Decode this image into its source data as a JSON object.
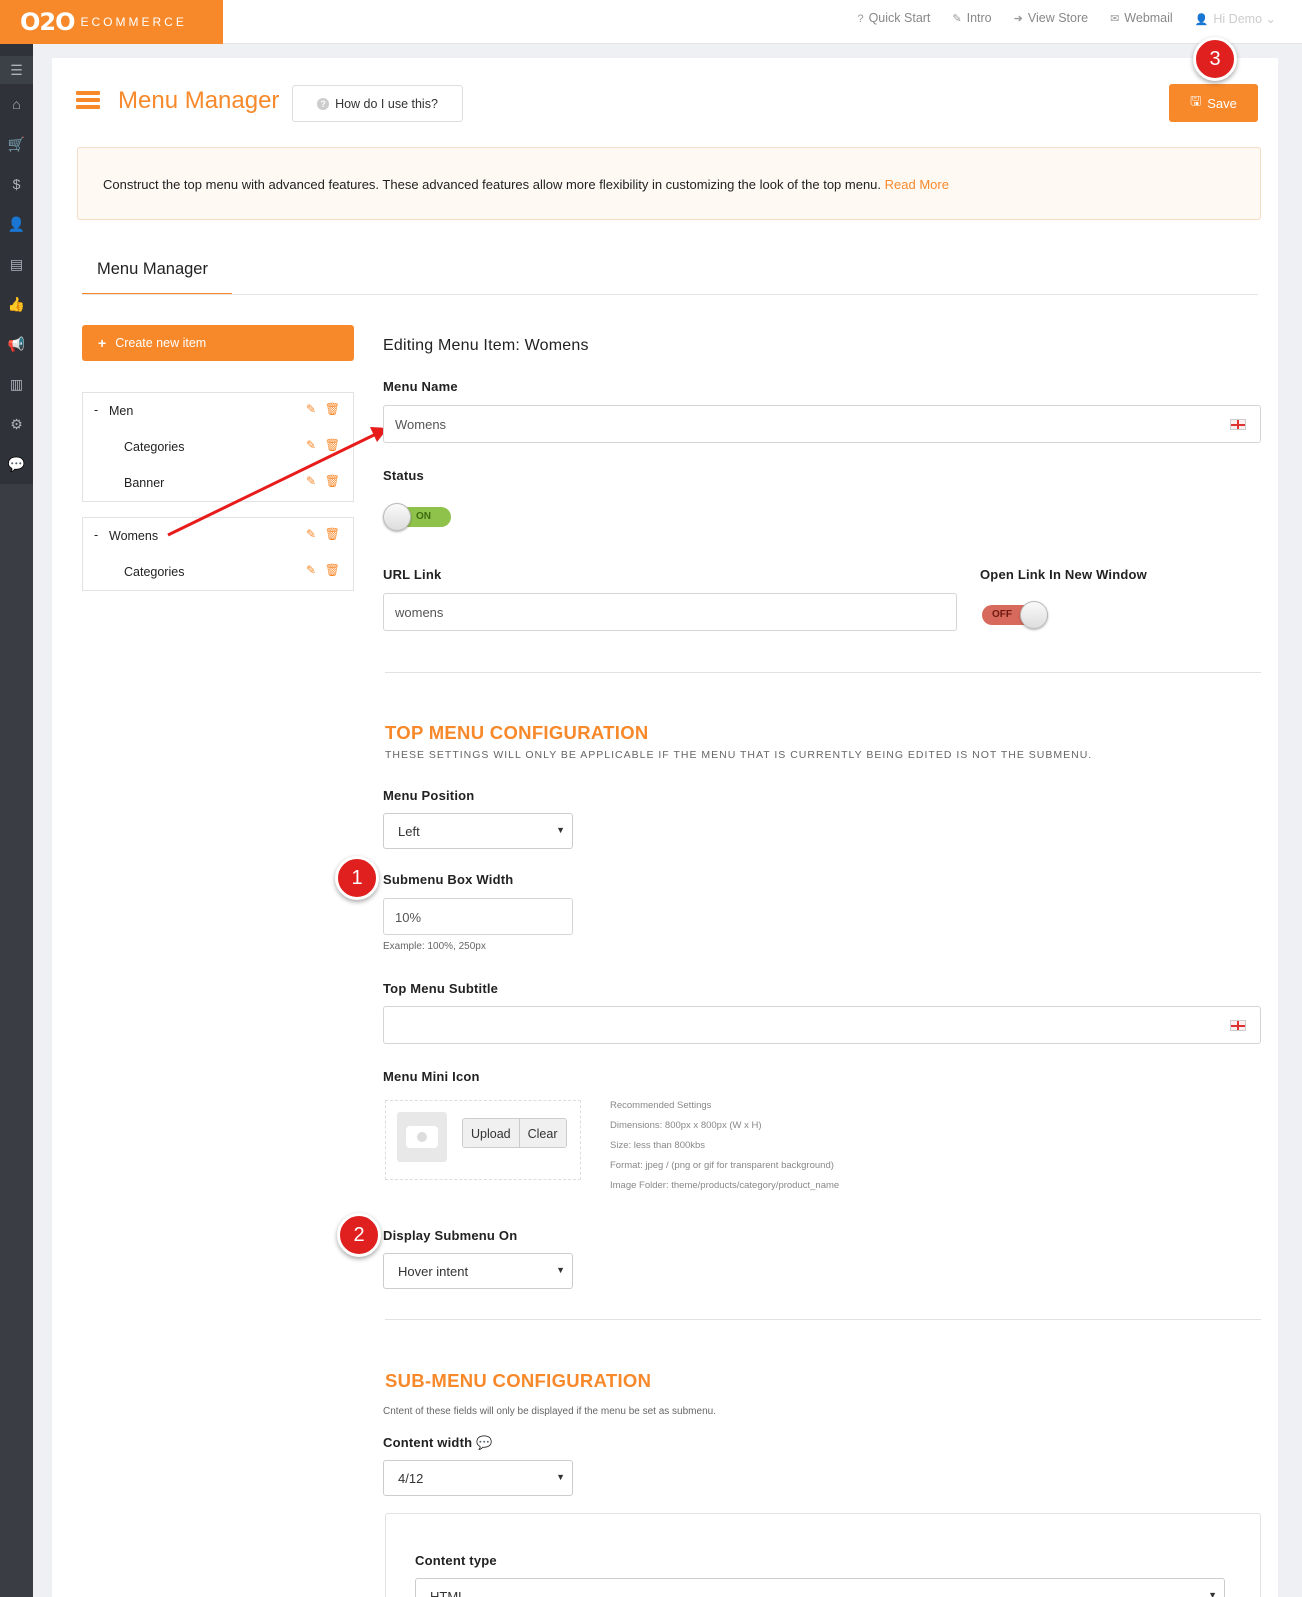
{
  "topbar": {
    "logo_big": "O2O",
    "logo_small": "ECOMMERCE",
    "links": [
      {
        "icon": "question-icon",
        "glyph": "?",
        "label": "Quick Start"
      },
      {
        "icon": "wand-icon",
        "glyph": "✎",
        "label": "Intro"
      },
      {
        "icon": "sign-in-icon",
        "glyph": "➜",
        "label": "View Store"
      },
      {
        "icon": "envelope-icon",
        "glyph": "✉",
        "label": "Webmail"
      }
    ],
    "user": "Hi Demo"
  },
  "sidenav": [
    "menu-icon",
    "home-icon",
    "cart-icon",
    "dollar-icon",
    "user-icon",
    "book-icon",
    "thumbs-up-icon",
    "bullhorn-icon",
    "bar-chart-icon",
    "cogs-icon",
    "comment-icon"
  ],
  "header": {
    "title": "Menu Manager",
    "help_button": "How do I use this?",
    "save_button": "Save"
  },
  "badges": {
    "one": "1",
    "two": "2",
    "three": "3"
  },
  "info": {
    "text": "Construct the top menu with advanced features. These advanced features allow more flexibility in customizing the look of the top menu.",
    "link": "Read More"
  },
  "tab": "Menu Manager",
  "sidebar": {
    "create_button": "Create new item",
    "tree": [
      {
        "label": "Men",
        "children": [
          "Categories",
          "Banner"
        ]
      },
      {
        "label": "Womens",
        "children": [
          "Categories"
        ]
      }
    ]
  },
  "editor": {
    "heading": "Editing Menu Item: Womens",
    "menu_name_label": "Menu Name",
    "menu_name_value": "Womens",
    "status_label": "Status",
    "status_value": "ON",
    "url_label": "URL Link",
    "url_value": "womens",
    "new_window_label": "Open Link In New Window",
    "new_window_value": "OFF"
  },
  "top_config": {
    "title": "TOP MENU CONFIGURATION",
    "subtitle": "THESE SETTINGS WILL ONLY BE APPLICABLE IF THE MENU THAT IS CURRENTLY BEING EDITED IS NOT THE SUBMENU.",
    "position_label": "Menu Position",
    "position_value": "Left",
    "width_label": "Submenu Box Width",
    "width_value": "10%",
    "width_help": "Example: 100%, 250px",
    "subtitle_label": "Top Menu Subtitle",
    "subtitle_value": "",
    "mini_icon_label": "Menu Mini Icon",
    "upload": "Upload",
    "clear": "Clear",
    "recommended": [
      "Recommended Settings",
      "Dimensions: 800px x 800px (W x H)",
      "Size: less than 800kbs",
      "Format: jpeg / (png or gif for transparent background)",
      "Image Folder: theme/products/category/product_name"
    ],
    "display_label": "Display Submenu On",
    "display_value": "Hover intent"
  },
  "sub_config": {
    "title": "SUB-MENU CONFIGURATION",
    "subtitle": "Cntent of these fields will only be displayed if the menu be set as submenu.",
    "content_width_label": "Content width",
    "content_width_value": "4/12",
    "content_type_label": "Content type",
    "content_type_value": "HTML"
  },
  "colors": {
    "accent": "#f7892b",
    "badge": "#e01f1f",
    "nav": "#2f3339",
    "toggle_on": "#8ec24b",
    "toggle_off": "#d86a5d"
  }
}
